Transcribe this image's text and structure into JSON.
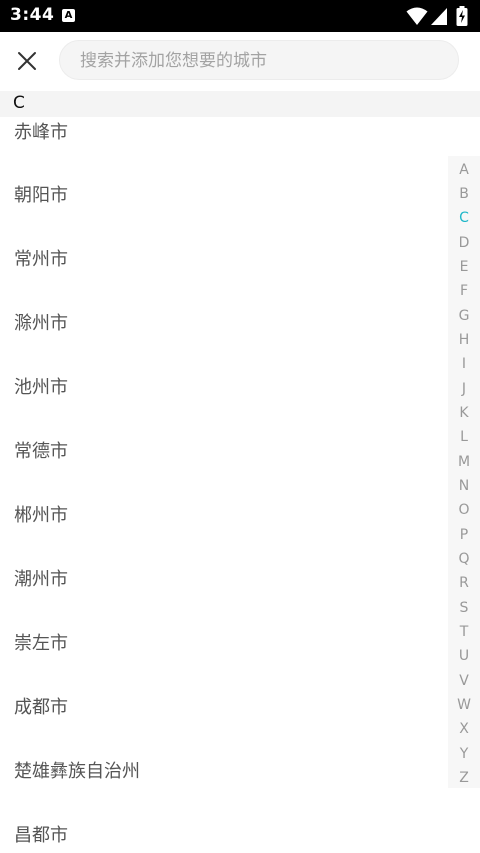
{
  "status_bar": {
    "time": "3:44",
    "notification_badge": "A",
    "icons": [
      "wifi-icon",
      "signal-icon",
      "battery-charging-icon"
    ]
  },
  "top_bar": {
    "close_icon": "close-icon",
    "search": {
      "placeholder": "搜索并添加您想要的城市",
      "value": ""
    }
  },
  "section": {
    "letter": "C"
  },
  "cities": [
    "赤峰市",
    "朝阳市",
    "常州市",
    "滁州市",
    "池州市",
    "常德市",
    "郴州市",
    "潮州市",
    "崇左市",
    "成都市",
    "楚雄彝族自治州",
    "昌都市"
  ],
  "index_bar": {
    "letters": [
      "A",
      "B",
      "C",
      "D",
      "E",
      "F",
      "G",
      "H",
      "I",
      "J",
      "K",
      "L",
      "M",
      "N",
      "O",
      "P",
      "Q",
      "R",
      "S",
      "T",
      "U",
      "V",
      "W",
      "X",
      "Y",
      "Z"
    ],
    "active": "C",
    "active_color": "#1fb7c8"
  }
}
